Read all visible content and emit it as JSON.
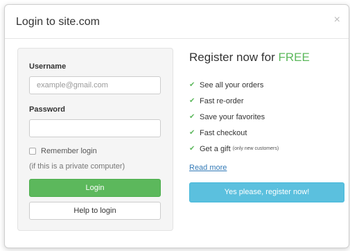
{
  "modal": {
    "title": "Login to site.com",
    "close_symbol": "×"
  },
  "login": {
    "username_label": "Username",
    "username_placeholder": "example@gmail.com",
    "username_value": "",
    "password_label": "Password",
    "password_value": "",
    "remember_label": "Remember login",
    "remember_checked": false,
    "remember_hint": "(if this is a private computer)",
    "login_button": "Login",
    "help_button": "Help to login"
  },
  "register": {
    "heading_prefix": "Register now for ",
    "heading_free": "FREE",
    "benefits": [
      {
        "text": "See all your orders",
        "note": ""
      },
      {
        "text": "Fast re-order",
        "note": ""
      },
      {
        "text": "Save your favorites",
        "note": ""
      },
      {
        "text": "Fast checkout",
        "note": ""
      },
      {
        "text": "Get a gift",
        "note": "(only new customers)"
      }
    ],
    "check_icon": "check-icon",
    "read_more": "Read more",
    "register_button": "Yes please, register now!"
  },
  "colors": {
    "success": "#5cb85c",
    "info": "#5bc0de",
    "link": "#337ab7"
  }
}
